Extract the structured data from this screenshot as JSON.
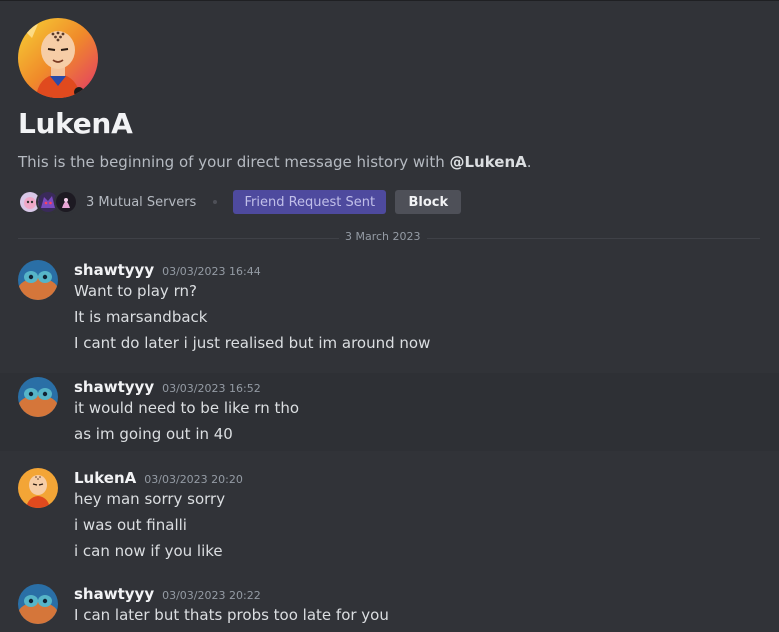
{
  "profile": {
    "name": "LukenA",
    "intro_prefix": "This is the beginning of your direct message history with ",
    "intro_mention": "@LukenA",
    "intro_suffix": ".",
    "mutual_servers": "3 Mutual Servers",
    "friend_request_button": "Friend Request Sent",
    "block_button": "Block"
  },
  "date_divider": "3 March 2023",
  "messages": [
    {
      "author": "shawtyyy",
      "timestamp": "03/03/2023 16:44",
      "lines": [
        "Want to play rn?",
        "It is marsandback",
        "I cant do later i just realised but im around now"
      ]
    },
    {
      "author": "shawtyyy",
      "timestamp": "03/03/2023 16:52",
      "lines": [
        "it would need to be like rn tho",
        "as im going out in 40"
      ]
    },
    {
      "author": "LukenA",
      "timestamp": "03/03/2023 20:20",
      "lines": [
        "hey man sorry sorry",
        "i was out finalli",
        "i can now if you like"
      ]
    },
    {
      "author": "shawtyyy",
      "timestamp": "03/03/2023 20:22",
      "lines": [
        "I can later but thats probs too late for you"
      ]
    }
  ],
  "colors": {
    "background": "#313338",
    "friend_request_bg": "#4e4a9e",
    "block_bg": "#4e5058"
  }
}
